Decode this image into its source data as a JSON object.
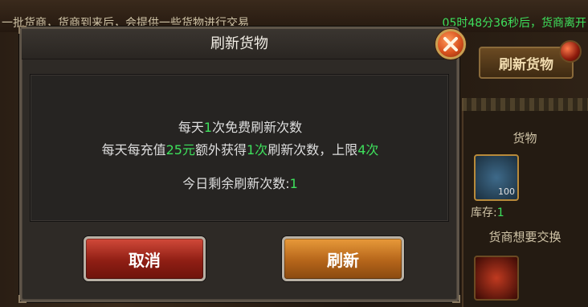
{
  "background": {
    "notice_left": "一批货商，货商到来后，会提供一些货物进行交易",
    "notice_right": "05时48分36秒后，货商离开",
    "refresh_goods_button": "刷新货物",
    "goods_label": "货物",
    "item_count": "100",
    "stock_label": "库存:",
    "stock_value": "1",
    "merchant_wants": "货商想要交换"
  },
  "dialog": {
    "title": "刷新货物",
    "line1": {
      "prefix": "每天",
      "num": "1",
      "suffix": "次免费刷新次数"
    },
    "line2": {
      "p1": "每天每充值",
      "amount": "25元",
      "p2": "额外获得",
      "times": "1次",
      "p3": "刷新次数，上限",
      "limit": "4次"
    },
    "line3": {
      "prefix": "今日剩余刷新次数:",
      "num": "1"
    },
    "cancel_label": "取消",
    "refresh_label": "刷新"
  },
  "colors": {
    "highlight": "#3ee05c",
    "text": "#dedede",
    "cancel_button": "#a82a1e",
    "refresh_button": "#c8761e"
  },
  "icons": {
    "close": "close-x-icon"
  }
}
